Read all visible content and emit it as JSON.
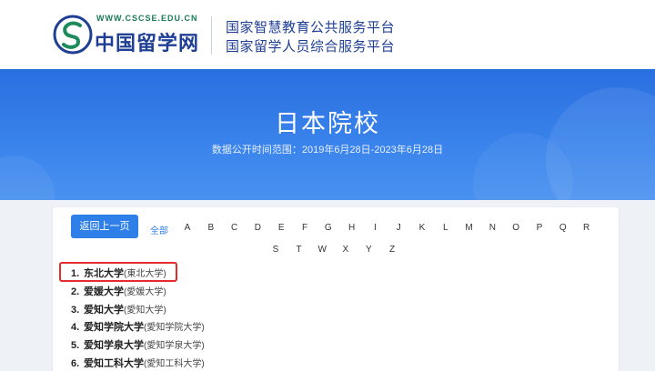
{
  "header": {
    "logo_url": "WWW.CSCSE.EDU.CN",
    "logo_text": "中国留学网",
    "line1": "国家智慧教育公共服务平台",
    "line2": "国家留学人员综合服务平台"
  },
  "banner": {
    "title": "日本院校",
    "subtitle": "数据公开时间范围：2019年6月28日-2023年6月28日"
  },
  "controls": {
    "back_label": "返回上一页",
    "all_label": "全部"
  },
  "letters_row1": [
    "A",
    "B",
    "C",
    "D",
    "E",
    "F",
    "G",
    "H",
    "I",
    "J",
    "K",
    "L",
    "M",
    "N",
    "O",
    "P",
    "Q",
    "R"
  ],
  "letters_row2": [
    "S",
    "T",
    "W",
    "X",
    "Y",
    "Z"
  ],
  "universities": [
    {
      "num": "1.",
      "name": "东北大学",
      "orig": "(東北大学)"
    },
    {
      "num": "2.",
      "name": "爱媛大学",
      "orig": "(愛媛大学)"
    },
    {
      "num": "3.",
      "name": "爱知大学",
      "orig": "(愛知大学)"
    },
    {
      "num": "4.",
      "name": "爱知学院大学",
      "orig": "(愛知学院大学)"
    },
    {
      "num": "5.",
      "name": "爱知学泉大学",
      "orig": "(愛知学泉大学)"
    },
    {
      "num": "6.",
      "name": "爱知工科大学",
      "orig": "(愛知工科大学)"
    }
  ],
  "colors": {
    "brand_blue": "#1f3f95",
    "banner_blue": "#2a6fe0",
    "button_blue": "#2f7fe9",
    "highlight_red": "#e52b2b"
  }
}
